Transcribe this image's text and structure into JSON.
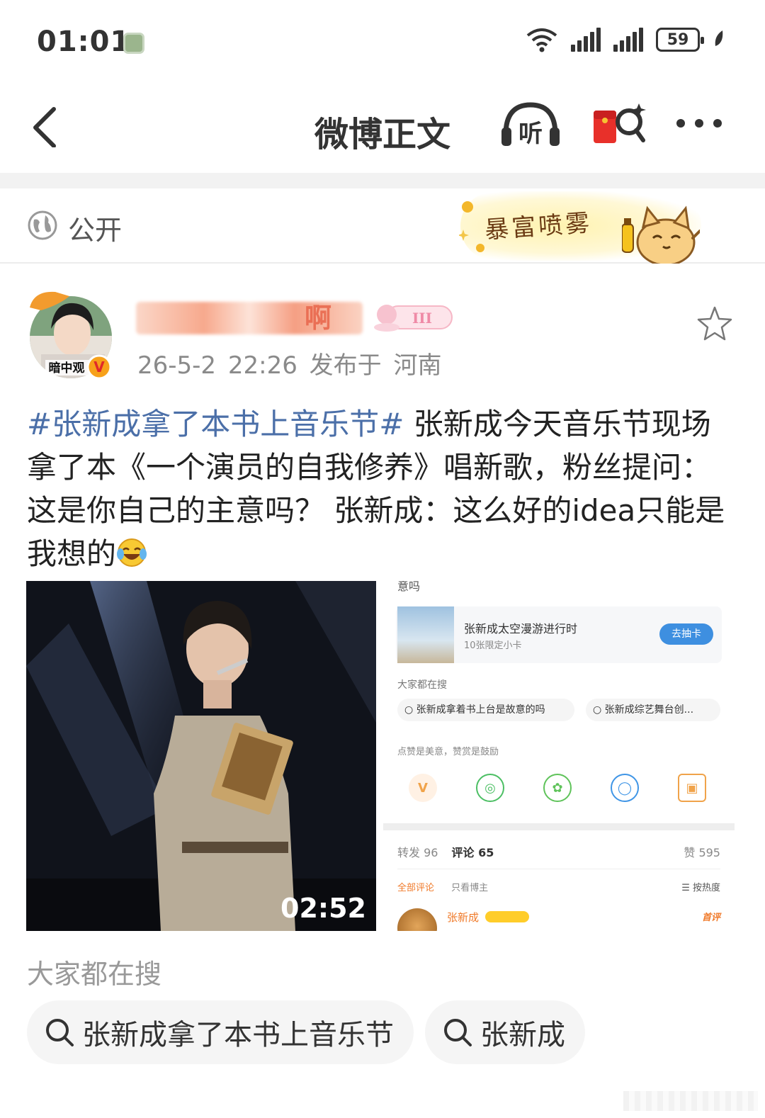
{
  "status_bar": {
    "time": "01:01",
    "battery": "59"
  },
  "nav": {
    "title": "微博正文",
    "listen_label": "听"
  },
  "visibility": {
    "label": "公开"
  },
  "promo": {
    "text": "暴富喷雾"
  },
  "post": {
    "avatar_caption": "暗中观",
    "user_fragment": "啊",
    "vip_level": "III",
    "meta": "26-5-2 22:26  发布于 河南",
    "hashtag": "#张新成拿了本书上音乐节#",
    "body": " 张新成今天音乐节现场拿了本《一个演员的自我修养》唱新歌，粉丝提问：这是你自己的主意吗？ 张新成：这么好的idea只能是我想的"
  },
  "video": {
    "duration": "02:52"
  },
  "screenshot": {
    "top_fragment": "意吗",
    "card_title": "张新成太空漫游进行时",
    "card_sub": "10张限定小卡",
    "card_button": "去抽卡",
    "search_label": "大家都在搜",
    "chips": [
      "张新成拿着书上台是故意的吗",
      "张新成综艺舞台创..."
    ],
    "note": "点赞是美意，赞赏是鼓励",
    "tab_repost": "转发 96",
    "tab_comment": "评论 65",
    "tab_like": "赞 595",
    "filter_all": "全部评论",
    "filter_author": "只看博主",
    "filter_sort": "☰ 按热度",
    "comment_name": "张新成",
    "comment_first": "首评"
  },
  "search": {
    "title": "大家都在搜",
    "items": [
      "张新成拿了本书上音乐节",
      "张新成"
    ]
  },
  "colors": {
    "hashtag": "#4b6fa8",
    "accent_orange": "#f07a2a",
    "blue_button": "#3e8fe0"
  }
}
